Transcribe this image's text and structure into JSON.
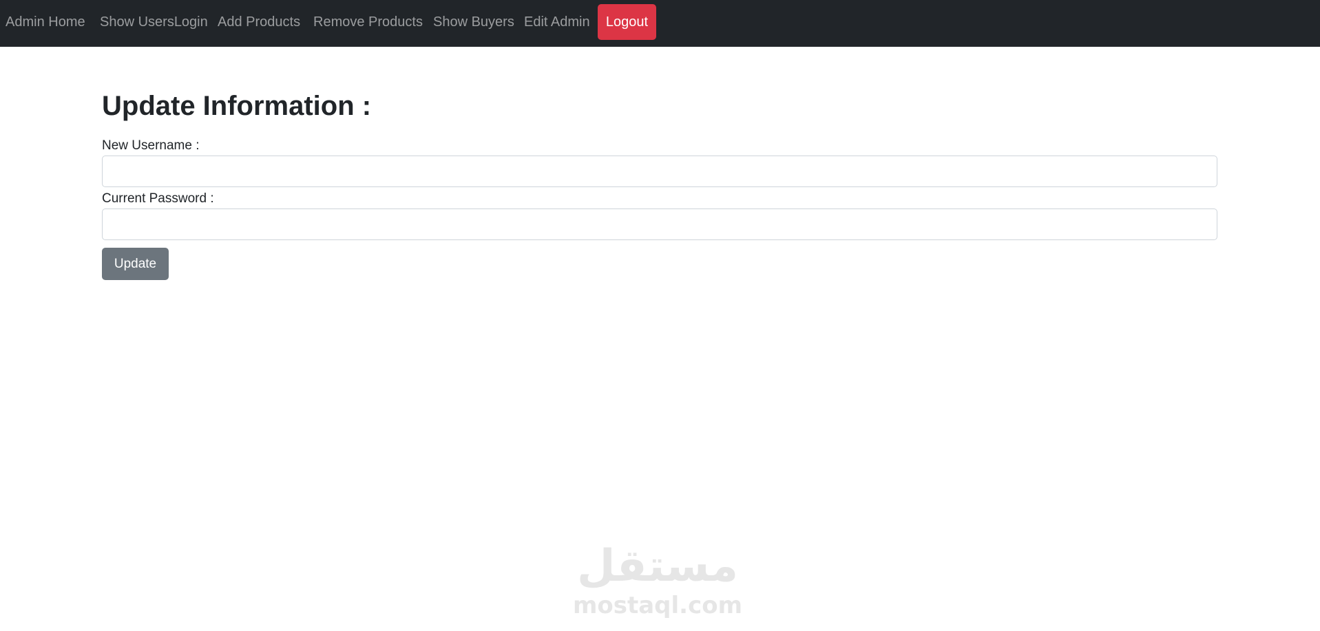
{
  "navbar": {
    "items": [
      {
        "label": "Admin Home"
      },
      {
        "label": "Show UsersLogin"
      },
      {
        "label": "Add Products"
      },
      {
        "label": "Remove Products"
      },
      {
        "label": "Show Buyers"
      },
      {
        "label": "Edit Admin"
      }
    ],
    "logout_label": "Logout",
    "background_color": "#212529",
    "logout_color": "#dc3545"
  },
  "main": {
    "title": "Update Information :",
    "fields": [
      {
        "label": "New Username :",
        "value": "",
        "placeholder": ""
      },
      {
        "label": "Current Password :",
        "value": "",
        "placeholder": ""
      }
    ],
    "submit_label": "Update",
    "submit_color": "#6c757d"
  },
  "watermark": {
    "arabic": "مستقل",
    "latin": "mostaql.com"
  }
}
